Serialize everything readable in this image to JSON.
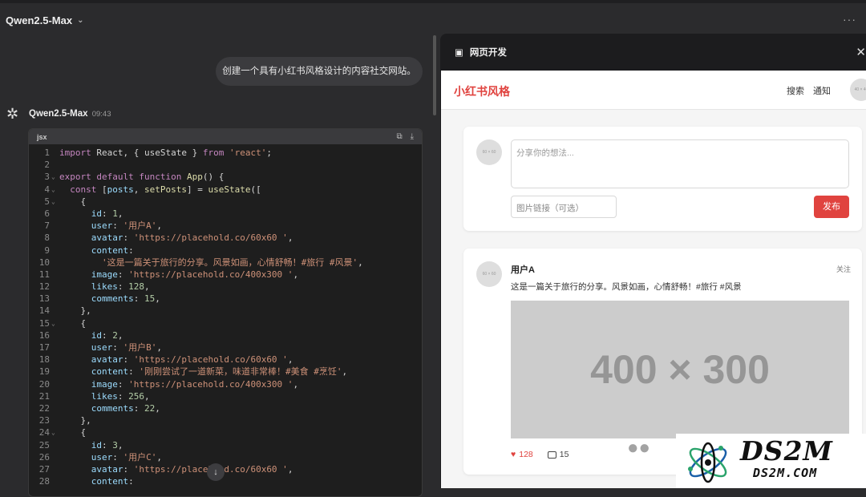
{
  "header": {
    "model_name": "Qwen2.5-Max",
    "more_label": "···"
  },
  "chat": {
    "user_message": "创建一个具有小红书风格设计的内容社交网站。",
    "assistant_name": "Qwen2.5-Max",
    "assistant_time": "09:43",
    "code_lang": "jsx"
  },
  "code_lines": [
    {
      "n": "1",
      "fold": "",
      "html": "<span class='kw'>import</span> React, { useState } <span class='kw'>from</span> <span class='str'>'react'</span>;"
    },
    {
      "n": "2",
      "fold": "",
      "html": ""
    },
    {
      "n": "3",
      "fold": "⌄",
      "html": "<span class='kw'>export default function</span> <span class='fn'>App</span>() {"
    },
    {
      "n": "4",
      "fold": "⌄",
      "html": "  <span class='kw'>const</span> [<span class='var'>posts</span>, <span class='fn'>setPosts</span>] = <span class='fn'>useState</span>(["
    },
    {
      "n": "5",
      "fold": "⌄",
      "html": "    {"
    },
    {
      "n": "6",
      "fold": "",
      "html": "      <span class='prop'>id</span>: <span class='num'>1</span>,"
    },
    {
      "n": "7",
      "fold": "",
      "html": "      <span class='prop'>user</span>: <span class='str'>'用户A'</span>,"
    },
    {
      "n": "8",
      "fold": "",
      "html": "      <span class='prop'>avatar</span>: <span class='str'>'https://placehold.co/60x60 '</span>,"
    },
    {
      "n": "9",
      "fold": "",
      "html": "      <span class='prop'>content</span>:"
    },
    {
      "n": "10",
      "fold": "",
      "html": "        <span class='str'>'这是一篇关于旅行的分享。风景如画，心情舒畅！#旅行 #风景'</span>,"
    },
    {
      "n": "11",
      "fold": "",
      "html": "      <span class='prop'>image</span>: <span class='str'>'https://placehold.co/400x300 '</span>,"
    },
    {
      "n": "12",
      "fold": "",
      "html": "      <span class='prop'>likes</span>: <span class='num'>128</span>,"
    },
    {
      "n": "13",
      "fold": "",
      "html": "      <span class='prop'>comments</span>: <span class='num'>15</span>,"
    },
    {
      "n": "14",
      "fold": "",
      "html": "    },"
    },
    {
      "n": "15",
      "fold": "⌄",
      "html": "    {"
    },
    {
      "n": "16",
      "fold": "",
      "html": "      <span class='prop'>id</span>: <span class='num'>2</span>,"
    },
    {
      "n": "17",
      "fold": "",
      "html": "      <span class='prop'>user</span>: <span class='str'>'用户B'</span>,"
    },
    {
      "n": "18",
      "fold": "",
      "html": "      <span class='prop'>avatar</span>: <span class='str'>'https://placehold.co/60x60 '</span>,"
    },
    {
      "n": "19",
      "fold": "",
      "html": "      <span class='prop'>content</span>: <span class='str'>'刚刚尝试了一道新菜，味道非常棒！#美食 #烹饪'</span>,"
    },
    {
      "n": "20",
      "fold": "",
      "html": "      <span class='prop'>image</span>: <span class='str'>'https://placehold.co/400x300 '</span>,"
    },
    {
      "n": "21",
      "fold": "",
      "html": "      <span class='prop'>likes</span>: <span class='num'>256</span>,"
    },
    {
      "n": "22",
      "fold": "",
      "html": "      <span class='prop'>comments</span>: <span class='num'>22</span>,"
    },
    {
      "n": "23",
      "fold": "",
      "html": "    },"
    },
    {
      "n": "24",
      "fold": "⌄",
      "html": "    {"
    },
    {
      "n": "25",
      "fold": "",
      "html": "      <span class='prop'>id</span>: <span class='num'>3</span>,"
    },
    {
      "n": "26",
      "fold": "",
      "html": "      <span class='prop'>user</span>: <span class='str'>'用户C'</span>,"
    },
    {
      "n": "27",
      "fold": "",
      "html": "      <span class='prop'>avatar</span>: <span class='str'>'https://placehold.co/60x60 '</span>,"
    },
    {
      "n": "28",
      "fold": "",
      "html": "      <span class='prop'>content</span>:"
    }
  ],
  "panel": {
    "title": "网页开发",
    "close_label": "✕"
  },
  "site": {
    "brand": "小红书风格",
    "nav_search": "搜索",
    "nav_notify": "通知",
    "avatar_text": "40 × 40",
    "composer": {
      "avatar_text": "60 × 60",
      "placeholder": "分享你的想法...",
      "image_placeholder": "图片链接（可选）",
      "publish_label": "发布"
    },
    "post": {
      "avatar_text": "60 × 60",
      "user": "用户A",
      "follow_label": "关注",
      "content": "这是一篇关于旅行的分享。风景如画，心情舒畅！#旅行 #风景",
      "image_text": "400 × 300",
      "likes": "128",
      "comments": "15"
    }
  },
  "watermark": {
    "title": "DS2M",
    "subtitle": "DS2M.COM"
  },
  "colors": {
    "accent": "#e0433f",
    "panel_bg": "#1c1c1e",
    "app_bg": "#2b2b2d"
  }
}
